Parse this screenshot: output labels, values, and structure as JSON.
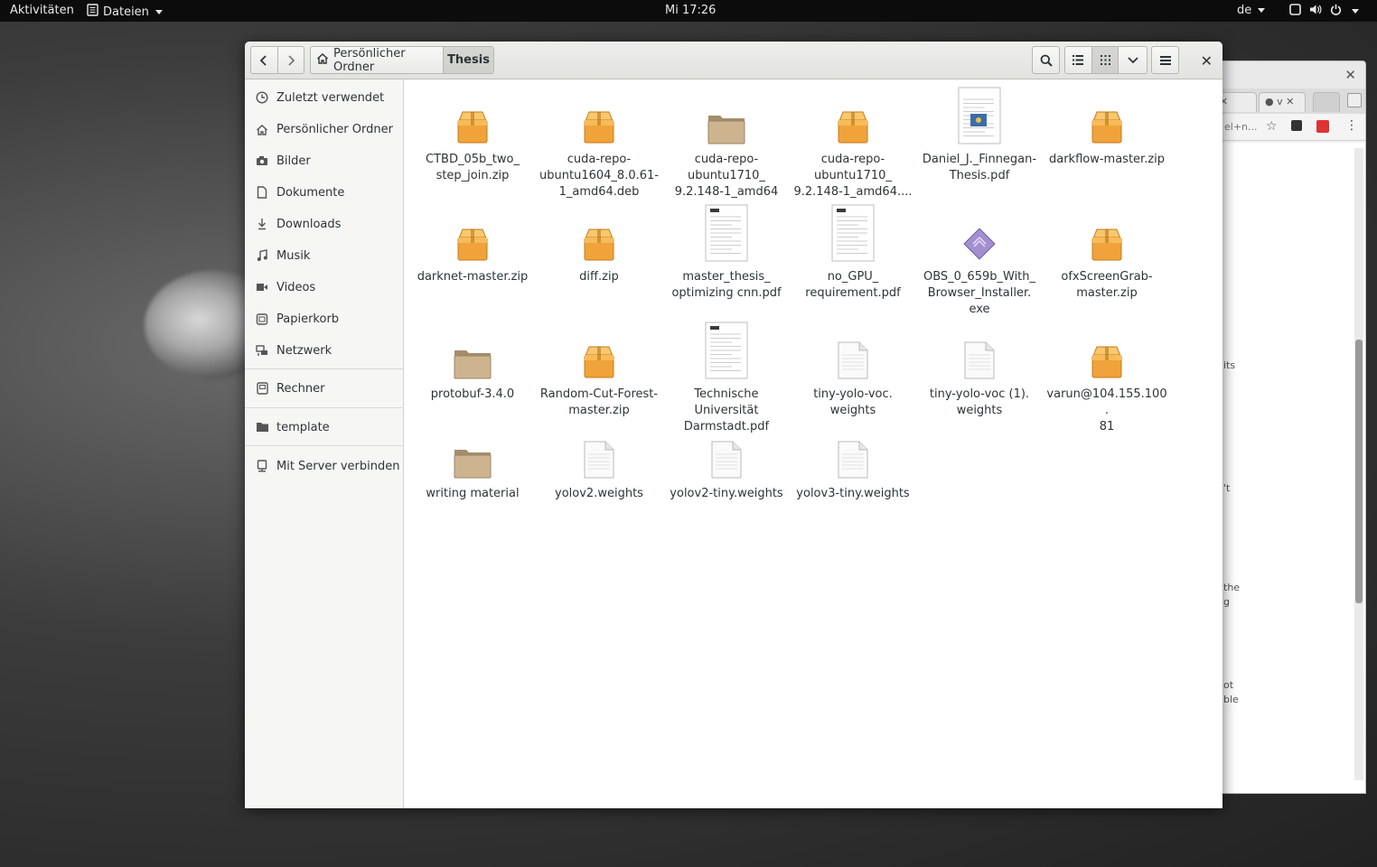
{
  "topbar": {
    "activities": "Aktivitäten",
    "app_menu": "Dateien",
    "clock": "Mi 17:26",
    "language": "de"
  },
  "browser": {
    "tab_fragments": [
      "(",
      "v"
    ],
    "url_fragment": "el+n...",
    "page_fragments": [
      "its",
      "'t",
      "the",
      "g",
      "ot",
      "ble"
    ]
  },
  "window": {
    "breadcrumb": [
      {
        "label": "Persönlicher Ordner",
        "icon": "home-icon"
      },
      {
        "label": "Thesis",
        "icon": ""
      }
    ],
    "view_mode": "grid"
  },
  "sidebar": {
    "items": [
      {
        "label": "Zuletzt verwendet",
        "icon": "clock-icon"
      },
      {
        "label": "Persönlicher Ordner",
        "icon": "home-icon"
      },
      {
        "label": "Bilder",
        "icon": "camera-icon"
      },
      {
        "label": "Dokumente",
        "icon": "document-icon"
      },
      {
        "label": "Downloads",
        "icon": "download-icon"
      },
      {
        "label": "Musik",
        "icon": "music-icon"
      },
      {
        "label": "Videos",
        "icon": "video-icon"
      },
      {
        "label": "Papierkorb",
        "icon": "trash-icon"
      },
      {
        "label": "Netzwerk",
        "icon": "network-icon"
      },
      {
        "label": "Rechner",
        "icon": "drive-icon"
      },
      {
        "label": "template",
        "icon": "folder-icon"
      },
      {
        "label": "Mit Server verbinden",
        "icon": "server-icon"
      }
    ]
  },
  "files": [
    {
      "label": "CTBD_05b_two_\nstep_join.zip",
      "type": "archive"
    },
    {
      "label": "cuda-repo-\nubuntu1604_8.0.61-\n1_amd64.deb",
      "type": "archive"
    },
    {
      "label": "cuda-repo-\nubuntu1710_\n9.2.148-1_amd64",
      "type": "folder"
    },
    {
      "label": "cuda-repo-\nubuntu1710_\n9.2.148-1_amd64....",
      "type": "archive"
    },
    {
      "label": "Daniel_J._Finnegan-\nThesis.pdf",
      "type": "pdf"
    },
    {
      "label": "darkflow-master.zip",
      "type": "archive"
    },
    {
      "label": "darknet-master.zip",
      "type": "archive"
    },
    {
      "label": "diff.zip",
      "type": "archive"
    },
    {
      "label": "master_thesis_\noptimizing cnn.pdf",
      "type": "pdf"
    },
    {
      "label": "no_GPU_\nrequirement.pdf",
      "type": "pdf"
    },
    {
      "label": "OBS_0_659b_With_\nBrowser_Installer.\nexe",
      "type": "exe"
    },
    {
      "label": "ofxScreenGrab-\nmaster.zip",
      "type": "archive"
    },
    {
      "label": "protobuf-3.4.0",
      "type": "folder"
    },
    {
      "label": "Random-Cut-Forest-\nmaster.zip",
      "type": "archive"
    },
    {
      "label": "Technische\nUniversität\nDarmstadt.pdf",
      "type": "pdf"
    },
    {
      "label": "tiny-yolo-voc.\nweights",
      "type": "text"
    },
    {
      "label": "tiny-yolo-voc (1).\nweights",
      "type": "text"
    },
    {
      "label": "varun@104.155.100.\n81",
      "type": "archive"
    },
    {
      "label": "writing material",
      "type": "folder"
    },
    {
      "label": "yolov2.weights",
      "type": "text"
    },
    {
      "label": "yolov2-tiny.weights",
      "type": "text"
    },
    {
      "label": "yolov3-tiny.weights",
      "type": "text"
    }
  ],
  "colors": {
    "archive": "#f0a33a",
    "folder": "#cdb48f",
    "exe": "#a38fd0"
  }
}
